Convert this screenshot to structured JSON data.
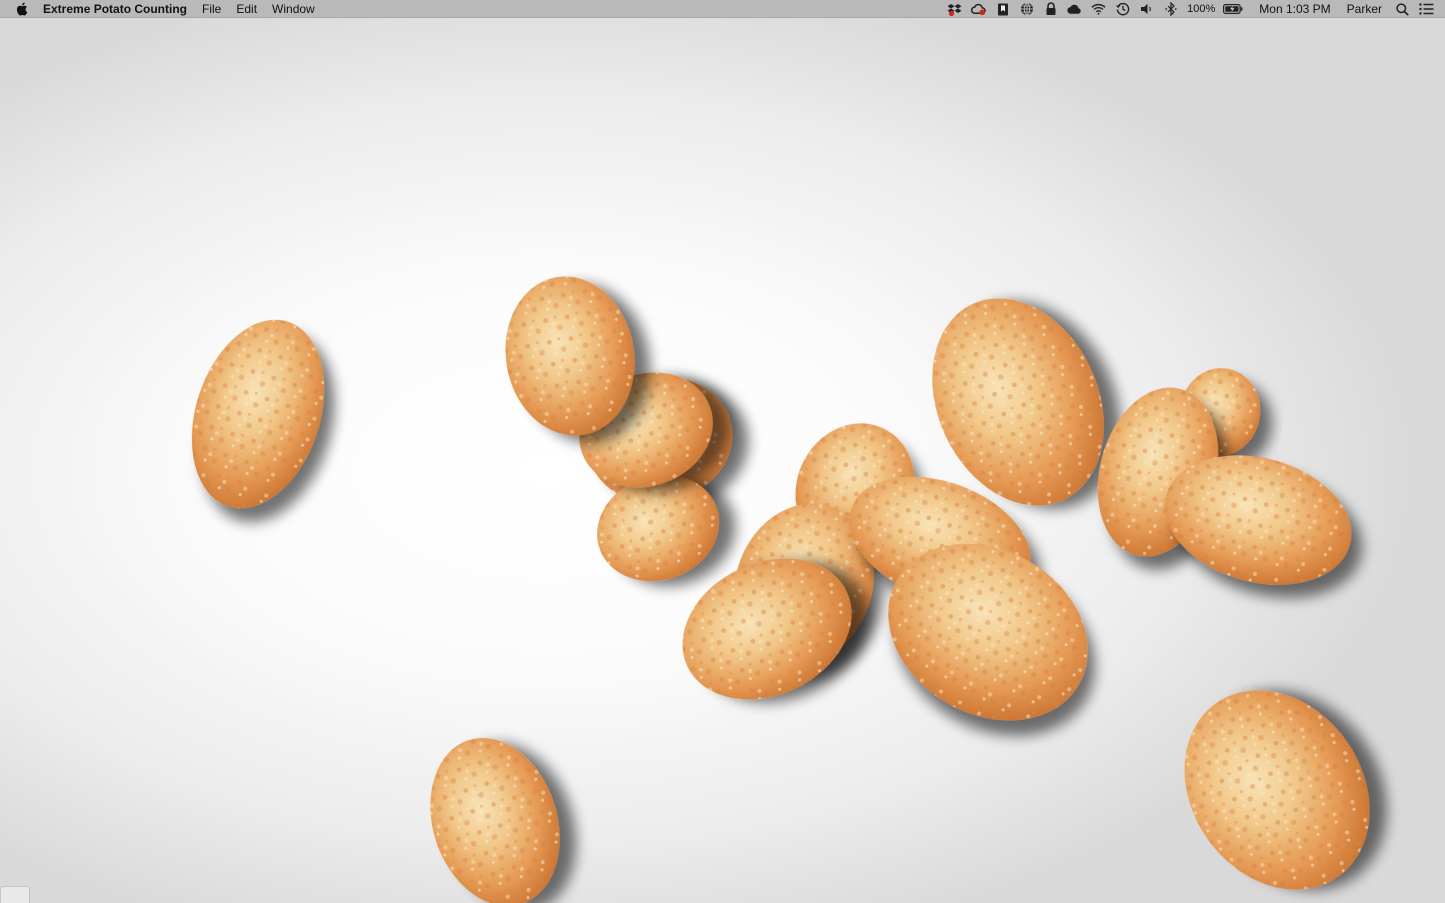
{
  "menubar": {
    "app_name": "Extreme Potato Counting",
    "menus": [
      "File",
      "Edit",
      "Window"
    ],
    "status_icons": [
      "dropbox-icon",
      "creative-cloud-icon",
      "bookmark-icon",
      "globe-icon",
      "lock-icon",
      "cloud-icon",
      "wifi-icon",
      "time-machine-icon",
      "volume-icon",
      "bluetooth-icon"
    ],
    "battery_percent": "100%",
    "clock": "Mon 1:03 PM",
    "user": "Parker"
  },
  "scene": {
    "description_free": true,
    "object": "potato",
    "potato_count": 17,
    "colors": {
      "potato_light": "#f6d9a8",
      "potato_mid": "#e9a45e",
      "potato_dark": "#cf7a3a",
      "background": "#f4f4f4",
      "menubar": "#b9b9b9"
    }
  }
}
